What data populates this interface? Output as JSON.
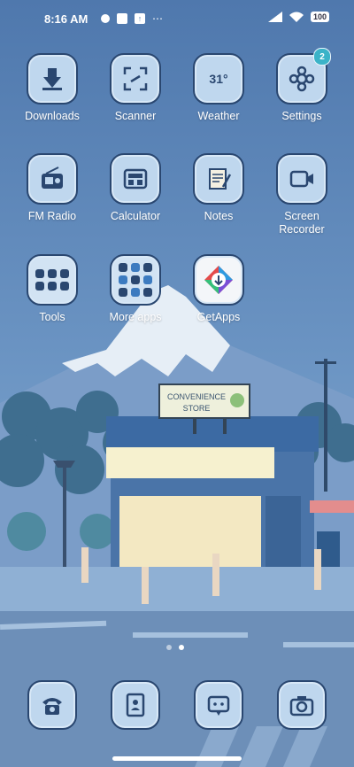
{
  "status": {
    "time": "8:16 AM",
    "battery": "100"
  },
  "apps": [
    {
      "label": "Downloads",
      "icon": "download-icon"
    },
    {
      "label": "Scanner",
      "icon": "scanner-icon"
    },
    {
      "label": "Weather",
      "icon": "weather-icon",
      "icon_text": "31°"
    },
    {
      "label": "Settings",
      "icon": "settings-icon",
      "badge": "2"
    },
    {
      "label": "FM Radio",
      "icon": "radio-icon"
    },
    {
      "label": "Calculator",
      "icon": "calculator-icon"
    },
    {
      "label": "Notes",
      "icon": "notes-icon"
    },
    {
      "label": "Screen Recorder",
      "icon": "screen-recorder-icon"
    },
    {
      "label": "Tools",
      "icon": "folder-icon"
    },
    {
      "label": "More apps",
      "icon": "folder-icon"
    },
    {
      "label": "GetApps",
      "icon": "getapps-icon"
    }
  ],
  "wallpaper": {
    "sign_line1": "CONVENIENCE",
    "sign_line2": "STORE"
  },
  "dock": [
    {
      "icon": "phone-icon"
    },
    {
      "icon": "contacts-icon"
    },
    {
      "icon": "messages-icon"
    },
    {
      "icon": "camera-icon"
    }
  ],
  "pages": {
    "count": 2,
    "current": 2
  },
  "colors": {
    "sky": "#5b84b6",
    "icon_bg": "#bfd7ee",
    "icon_border": "#2a4770",
    "badge": "#3bb3c8"
  }
}
